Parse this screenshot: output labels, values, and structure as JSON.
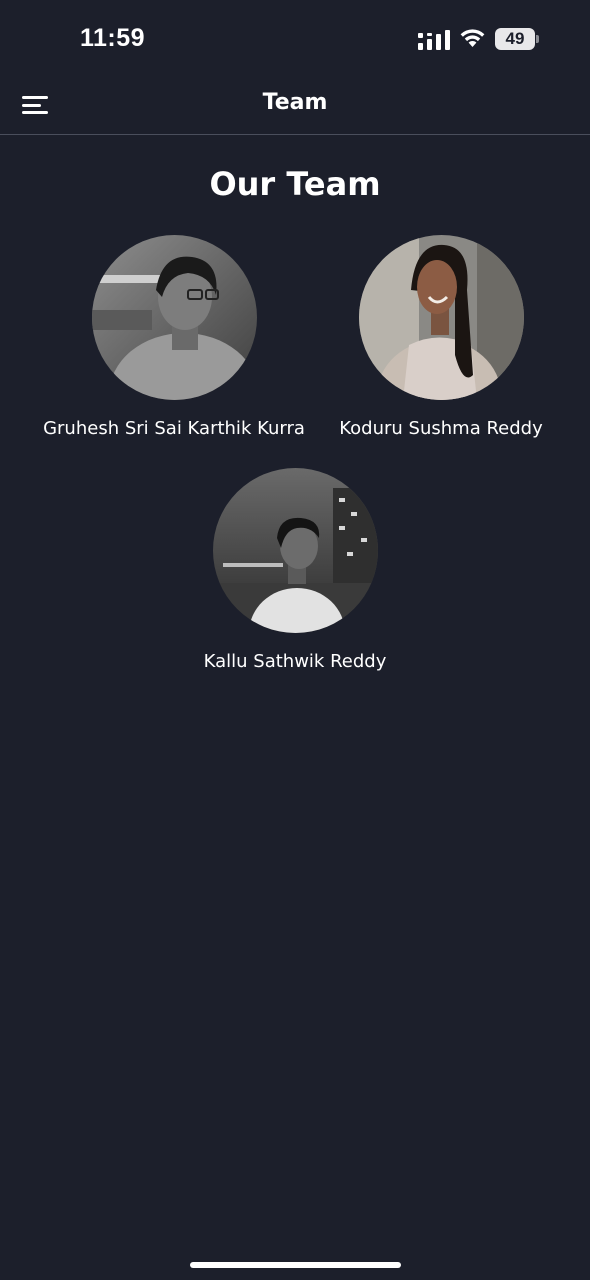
{
  "status_bar": {
    "time": "11:59",
    "battery_level": "49",
    "icons": [
      "signal-icon",
      "wifi-icon",
      "battery-icon"
    ]
  },
  "header": {
    "title": "Team",
    "menu_icon": "hamburger-menu-icon"
  },
  "page": {
    "heading": "Our Team"
  },
  "team": [
    {
      "name": "Gruhesh Sri Sai Karthik Kurra",
      "photo": "grayscale portrait photo"
    },
    {
      "name": "Koduru Sushma Reddy",
      "photo": "color portrait photo"
    },
    {
      "name": "Kallu Sathwik Reddy",
      "photo": "grayscale night city portrait photo"
    }
  ],
  "colors": {
    "background": "#1c1f2b",
    "text": "#ffffff",
    "divider": "#4a4e5c"
  }
}
